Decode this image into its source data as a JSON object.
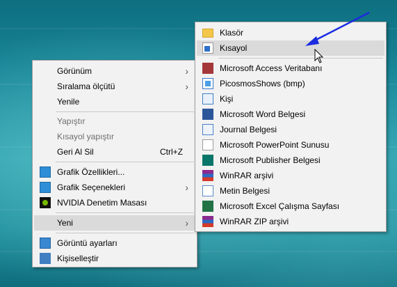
{
  "main_menu": {
    "items": [
      {
        "label": "Görünüm",
        "submenu": true
      },
      {
        "label": "Sıralama ölçütü",
        "submenu": true
      },
      {
        "label": "Yenile"
      },
      {
        "label": "Yapıştır",
        "disabled": true
      },
      {
        "label": "Kısayol yapıştır",
        "disabled": true
      },
      {
        "label": "Geri Al Sil",
        "shortcut": "Ctrl+Z"
      },
      {
        "label": "Grafik Özellikleri...",
        "icon": "graphics-icon"
      },
      {
        "label": "Grafik Seçenekleri",
        "icon": "graphics-icon",
        "submenu": true
      },
      {
        "label": "NVIDIA Denetim Masası",
        "icon": "nvidia-icon"
      },
      {
        "label": "Yeni",
        "submenu": true,
        "highlighted": true
      },
      {
        "label": "Görüntü ayarları",
        "icon": "display-settings-icon"
      },
      {
        "label": "Kişiselleştir",
        "icon": "personalize-icon"
      }
    ]
  },
  "sub_menu": {
    "items": [
      {
        "label": "Klasör",
        "icon": "folder-icon"
      },
      {
        "label": "Kısayol",
        "icon": "shortcut-icon",
        "highlighted": true
      },
      {
        "label": "Microsoft Access Veritabanı",
        "icon": "access-icon"
      },
      {
        "label": "PicosmosShows (bmp)",
        "icon": "bitmap-icon"
      },
      {
        "label": "Kişi",
        "icon": "contact-icon"
      },
      {
        "label": "Microsoft Word Belgesi",
        "icon": "word-icon"
      },
      {
        "label": "Journal Belgesi",
        "icon": "journal-icon"
      },
      {
        "label": "Microsoft PowerPoint Sunusu",
        "icon": "powerpoint-icon"
      },
      {
        "label": "Microsoft Publisher Belgesi",
        "icon": "publisher-icon"
      },
      {
        "label": "WinRAR arşivi",
        "icon": "winrar-icon"
      },
      {
        "label": "Metin Belgesi",
        "icon": "text-document-icon"
      },
      {
        "label": "Microsoft Excel Çalışma Sayfası",
        "icon": "excel-icon"
      },
      {
        "label": "WinRAR ZIP arşivi",
        "icon": "winrar-zip-icon"
      }
    ]
  },
  "colors": {
    "menu_background": "#f2f2f2",
    "highlight": "#dadada",
    "annotation_arrow": "#1a2be0"
  }
}
